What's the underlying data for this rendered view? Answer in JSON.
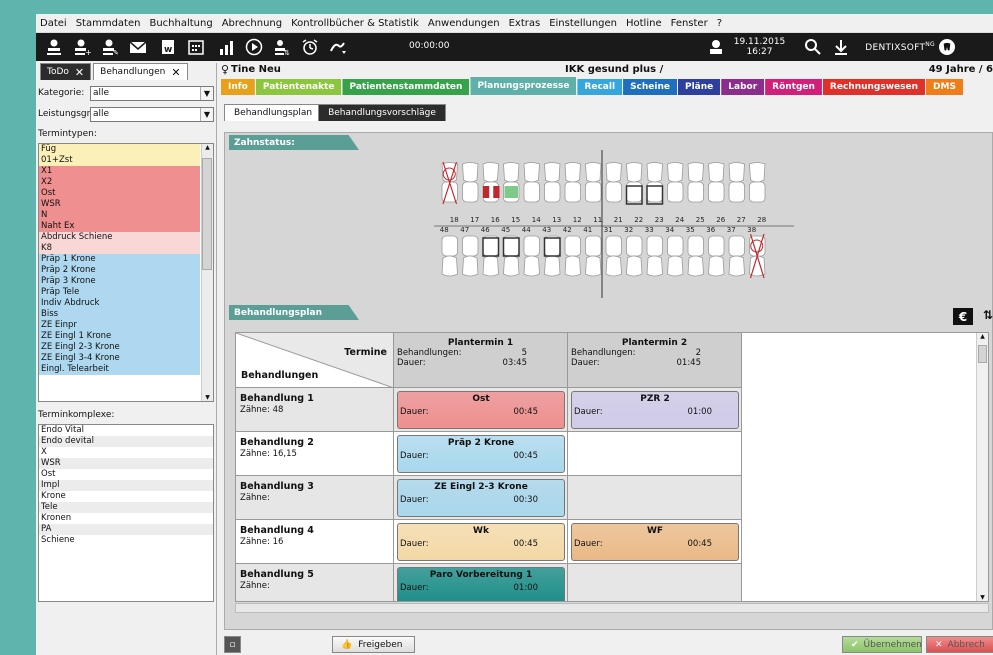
{
  "menu": [
    "Datei",
    "Stammdaten",
    "Buchhaltung",
    "Abrechnung",
    "Kontrollbücher & Statistik",
    "Anwendungen",
    "Extras",
    "Einstellungen",
    "Hotline",
    "Fenster",
    "?"
  ],
  "toolbar": {
    "icons": [
      "user-icon",
      "user-add-icon",
      "user-edit-icon",
      "mail-icon",
      "word-icon",
      "calendar-icon",
      "chart-icon",
      "play-icon",
      "user-time-icon",
      "alarm-icon",
      "signature-icon"
    ],
    "timer": "00:00:00",
    "date": "19.11.2015",
    "time": "16:27",
    "brand": "DENTIXSOFT",
    "brand_sup": "NG"
  },
  "left": {
    "tabs": [
      {
        "label": "ToDo"
      },
      {
        "label": "Behandlungen"
      }
    ],
    "kategorie_label": "Kategorie:",
    "kategorie_value": "alle",
    "leistung_label": "Leistungsgr.:",
    "leistung_value": "alle",
    "termintypen_label": "Termintypen:",
    "termintypen": [
      {
        "label": "Füg",
        "color": "#fbf1b8"
      },
      {
        "label": "01+Zst",
        "color": "#fbf1b8"
      },
      {
        "label": "X1",
        "color": "#ef8f8f"
      },
      {
        "label": "X2",
        "color": "#ef8f8f"
      },
      {
        "label": "Ost",
        "color": "#ef8f8f"
      },
      {
        "label": "WSR",
        "color": "#ef8f8f"
      },
      {
        "label": "N",
        "color": "#ef8f8f"
      },
      {
        "label": "Naht Ex",
        "color": "#ef8f8f"
      },
      {
        "label": "Abdruck Schiene",
        "color": "#fad7d7"
      },
      {
        "label": "K8",
        "color": "#fad7d7"
      },
      {
        "label": "Präp 1 Krone",
        "color": "#aed8ef"
      },
      {
        "label": "Präp 2 Krone",
        "color": "#aed8ef"
      },
      {
        "label": "Präp 3 Krone",
        "color": "#aed8ef"
      },
      {
        "label": "Präp Tele",
        "color": "#aed8ef"
      },
      {
        "label": "Indiv Abdruck",
        "color": "#aed8ef"
      },
      {
        "label": "Biss",
        "color": "#aed8ef"
      },
      {
        "label": "ZE Einpr",
        "color": "#aed8ef"
      },
      {
        "label": "ZE Eingl 1 Krone",
        "color": "#aed8ef"
      },
      {
        "label": "ZE Eingl 2-3 Krone",
        "color": "#aed8ef"
      },
      {
        "label": "ZE Eingl 3-4  Krone",
        "color": "#aed8ef"
      },
      {
        "label": "Eingl. Telearbeit",
        "color": "#aed8ef"
      }
    ],
    "terminkomplexe_label": "Terminkomplexe:",
    "terminkomplexe": [
      "Endo Vital",
      "Endo devital",
      "X",
      "WSR",
      "Ost",
      "Impl",
      "Krone",
      "Tele",
      "Kronen",
      "PA",
      "Schiene"
    ]
  },
  "patient": {
    "name": "Tine Neu",
    "insurance": "IKK gesund plus /",
    "age": "49 Jahre / 6"
  },
  "tabs": [
    {
      "label": "Info",
      "color": "#e8a11a"
    },
    {
      "label": "Patientenakte",
      "color": "#8cc63f"
    },
    {
      "label": "Patientenstammdaten",
      "color": "#36a24a"
    },
    {
      "label": "Planungsprozesse",
      "color": "#5fb0a8"
    },
    {
      "label": "Recall",
      "color": "#37a6dd"
    },
    {
      "label": "Scheine",
      "color": "#1f6fbf"
    },
    {
      "label": "Pläne",
      "color": "#2e3f9e"
    },
    {
      "label": "Labor",
      "color": "#8a2d8c"
    },
    {
      "label": "Röntgen",
      "color": "#d11f7a"
    },
    {
      "label": "Rechnungswesen",
      "color": "#e0302a"
    },
    {
      "label": "DMS",
      "color": "#ef7d1a"
    }
  ],
  "subtabs": [
    {
      "label": "Behandlungsplan"
    },
    {
      "label": "Behandlungsvorschläge"
    }
  ],
  "zahnstatus": {
    "title": "Zahnstatus:",
    "upper": [
      "18",
      "17",
      "16",
      "15",
      "14",
      "13",
      "12",
      "11",
      "21",
      "22",
      "23",
      "24",
      "25",
      "26",
      "27",
      "28"
    ],
    "lower": [
      "48",
      "47",
      "46",
      "45",
      "44",
      "43",
      "42",
      "41",
      "31",
      "32",
      "33",
      "34",
      "35",
      "36",
      "37",
      "38"
    ]
  },
  "plan": {
    "title": "Behandlungsplan",
    "euro": "€",
    "corner_top": "Termine",
    "corner_bottom": "Behandlungen",
    "columns": [
      {
        "title": "Plantermin 1",
        "behandlungen_label": "Behandlungen:",
        "behandlungen": "5",
        "dauer_label": "Dauer:",
        "dauer": "03:45"
      },
      {
        "title": "Plantermin 2",
        "behandlungen_label": "Behandlungen:",
        "behandlungen": "2",
        "dauer_label": "Dauer:",
        "dauer": "01:45"
      }
    ],
    "rows": [
      {
        "title": "Behandlung 1",
        "zaehne": "Zähne: 48",
        "cells": [
          {
            "name": "Ost",
            "dauer": "00:45",
            "color": "#ef8f8f"
          },
          {
            "name": "PZR 2",
            "dauer": "01:00",
            "color": "#cfcbe9"
          }
        ]
      },
      {
        "title": "Behandlung 2",
        "zaehne": "Zähne: 16,15",
        "cells": [
          {
            "name": "Präp 2 Krone",
            "dauer": "00:45",
            "color": "#a9d7ec"
          },
          null
        ]
      },
      {
        "title": "Behandlung 3",
        "zaehne": "Zähne:",
        "cells": [
          {
            "name": "ZE Eingl 2-3 Krone",
            "dauer": "00:30",
            "color": "#a9d7ec"
          },
          null
        ]
      },
      {
        "title": "Behandlung 4",
        "zaehne": "Zähne: 16",
        "cells": [
          {
            "name": "Wk",
            "dauer": "00:45",
            "color": "#f3d8a6"
          },
          {
            "name": "WF",
            "dauer": "00:45",
            "color": "#e9b986"
          }
        ]
      },
      {
        "title": "Behandlung 5",
        "zaehne": "Zähne:",
        "cells": [
          {
            "name": "Paro Vorbereitung 1",
            "dauer": "01:00",
            "color": "#1c8e88"
          },
          null
        ]
      }
    ],
    "dauer_label": "Dauer:"
  },
  "buttons": {
    "freigeben": "Freigeben",
    "uebernehmen": "Übernehmen",
    "abbrechen": "Abbrech"
  }
}
